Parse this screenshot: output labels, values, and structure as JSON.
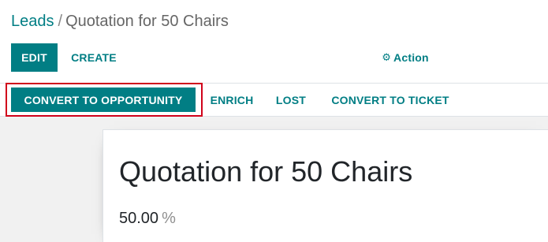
{
  "breadcrumb": {
    "parent": "Leads",
    "separator": "/",
    "current": "Quotation for 50 Chairs"
  },
  "toolbar": {
    "edit_label": "EDIT",
    "create_label": "CREATE",
    "action_label": "Action",
    "action_icon": "gear-icon"
  },
  "statusbar": {
    "convert_opportunity_label": "CONVERT TO OPPORTUNITY",
    "enrich_label": "ENRICH",
    "lost_label": "LOST",
    "convert_ticket_label": "CONVERT TO TICKET"
  },
  "form": {
    "title": "Quotation for 50 Chairs",
    "probability_value": "50.00",
    "probability_unit": "%"
  },
  "colors": {
    "accent": "#017e84",
    "highlight": "#d0021b"
  }
}
